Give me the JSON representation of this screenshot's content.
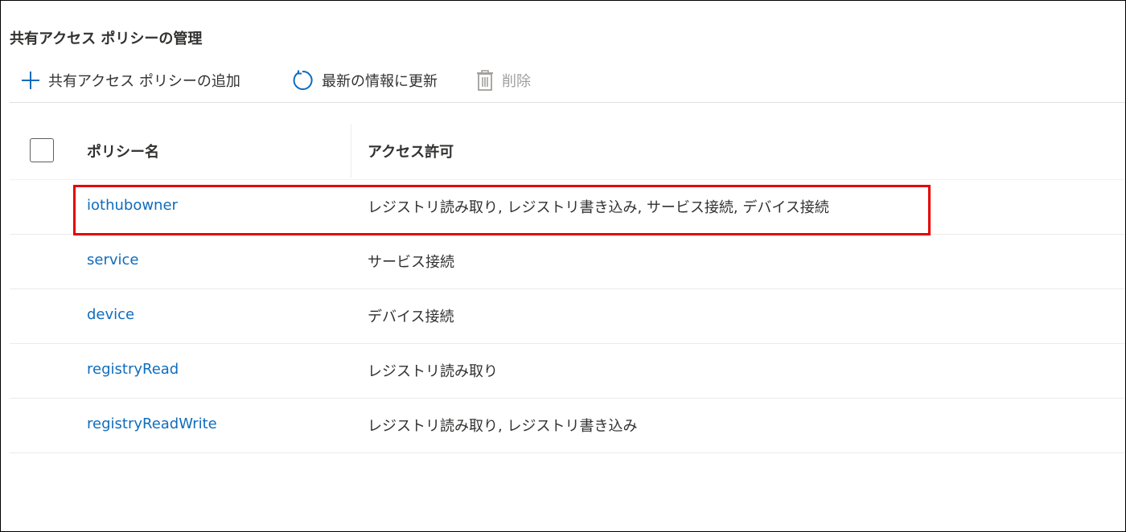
{
  "page": {
    "title": "共有アクセス ポリシーの管理"
  },
  "toolbar": {
    "add_label": "共有アクセス ポリシーの追加",
    "refresh_label": "最新の情報に更新",
    "delete_label": "削除"
  },
  "grid": {
    "columns": [
      "ポリシー名",
      "アクセス許可"
    ],
    "rows": [
      {
        "name": "iothubowner",
        "permissions": "レジストリ読み取り, レジストリ書き込み, サービス接続, デバイス接続"
      },
      {
        "name": "service",
        "permissions": "サービス接続"
      },
      {
        "name": "device",
        "permissions": "デバイス接続"
      },
      {
        "name": "registryRead",
        "permissions": "レジストリ読み取り"
      },
      {
        "name": "registryReadWrite",
        "permissions": "レジストリ読み取り, レジストリ書き込み"
      }
    ]
  },
  "colors": {
    "link": "#0f6cbd",
    "highlight": "#e60000",
    "disabled": "#a19f9d"
  },
  "icons": {
    "add": "plus-icon",
    "refresh": "refresh-icon",
    "delete": "trash-icon"
  }
}
